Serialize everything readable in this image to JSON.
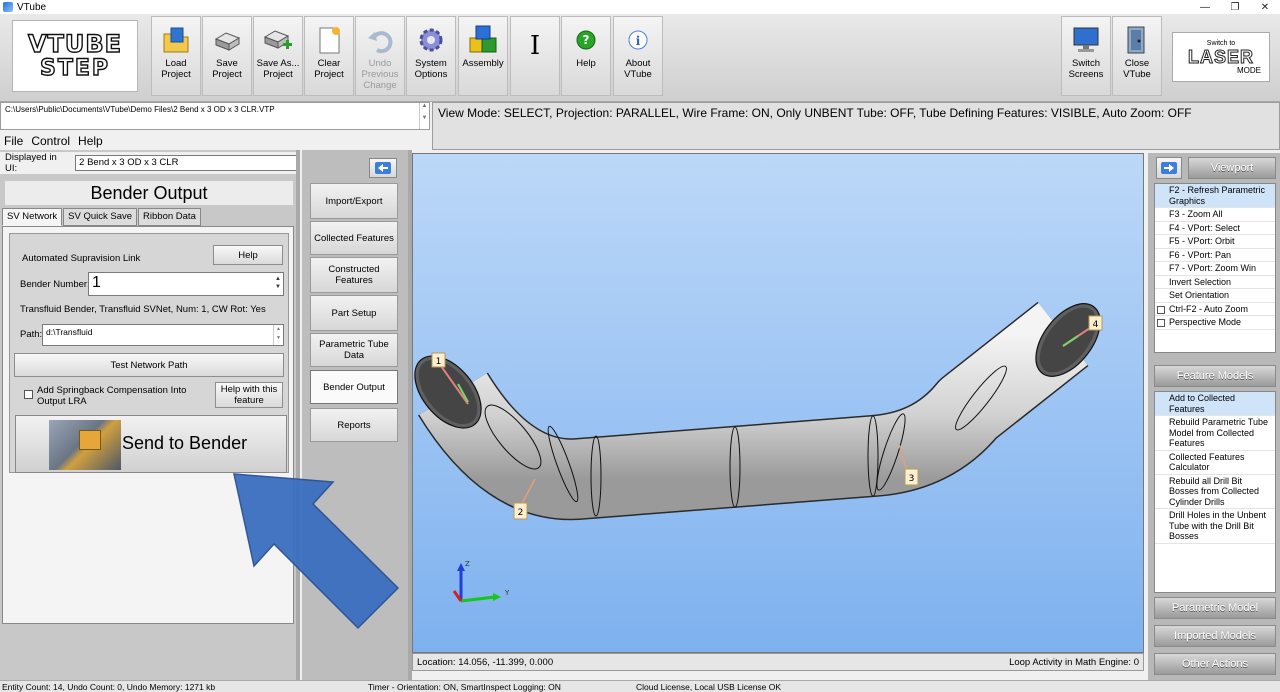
{
  "window": {
    "title": "VTube"
  },
  "logo": {
    "line1": "VTUBE",
    "line2": "STEP"
  },
  "ribbon": {
    "buttons": [
      {
        "id": "load",
        "label": "Load Project"
      },
      {
        "id": "save",
        "label": "Save Project"
      },
      {
        "id": "saveas",
        "label": "Save As... Project"
      },
      {
        "id": "clear",
        "label": "Clear Project"
      },
      {
        "id": "undo",
        "label": "Undo Previous Change"
      },
      {
        "id": "sysopt",
        "label": "System Options"
      },
      {
        "id": "assembly",
        "label": "Assembly"
      },
      {
        "id": "cursor",
        "label": ""
      },
      {
        "id": "help",
        "label": "Help"
      },
      {
        "id": "about",
        "label": "About VTube"
      },
      {
        "id": "switch",
        "label": "Switch Screens"
      },
      {
        "id": "close",
        "label": "Close VTube"
      }
    ],
    "laser_mode": {
      "top": "Switch to",
      "main": "LASER",
      "bottom": "MODE"
    }
  },
  "file_path": "C:\\Users\\Public\\Documents\\VTube\\Demo Files\\2 Bend x 3 OD x 3 CLR.VTP",
  "view_mode": "View Mode: SELECT, Projection: PARALLEL, Wire Frame: ON, Only UNBENT Tube: OFF, Tube Defining Features: VISIBLE, Auto Zoom: OFF",
  "menu": {
    "file": "File",
    "control": "Control",
    "help": "Help"
  },
  "left": {
    "displayed_label": "Displayed in UI:",
    "displayed_value": "2 Bend x 3 OD x 3 CLR",
    "header": "Bender Output",
    "tabs": [
      "SV Network",
      "SV Quick Save",
      "Ribbon Data"
    ],
    "auto_link": "Automated Supravision Link",
    "help_button": "Help",
    "bender_number_label": "Bender Number:",
    "bender_number_value": "1",
    "transfluid_info": "Transfluid Bender, Transfluid SVNet, Num: 1, CW Rot: Yes",
    "path_label": "Path:",
    "path_value": "d:\\Transfluid",
    "test_button": "Test Network Path",
    "springback_label": "Add Springback Compensation Into Output LRA",
    "help_feature_button": "Help with this feature",
    "send_button": "Send to Bender"
  },
  "middle_nav": [
    "Import/Export",
    "Collected Features",
    "Constructed Features",
    "Part Setup",
    "Parametric Tube Data",
    "Bender Output",
    "Reports"
  ],
  "viewport": {
    "markers": [
      "1",
      "2",
      "3",
      "4"
    ],
    "axes": {
      "z": "Z",
      "y": "Y"
    },
    "location": "Location: 14.056, -11.399, 0.000",
    "loop_activity": "Loop Activity in Math Engine:  0"
  },
  "right": {
    "viewport_header": "Viewport",
    "viewport_items": [
      "F2 - Refresh Parametric Graphics",
      "F3 - Zoom All",
      "F4 - VPort: Select",
      "F5 - VPort: Orbit",
      "F6 - VPort: Pan",
      "F7 - VPort: Zoom Win",
      "Invert Selection",
      "Set Orientation",
      "Ctrl-F2 - Auto Zoom",
      "Perspective Mode"
    ],
    "feature_models_header": "Feature Models",
    "feature_items": [
      "Add to Collected Features",
      "Rebuild Parametric Tube Model from Collected Features",
      "Collected Features Calculator",
      "Rebuild all Drill Bit Bosses from Collected Cylinder Drills",
      "Drill Holes in the Unbent Tube with the Drill Bit Bosses"
    ],
    "parametric_model": "Parametric Model",
    "imported_models": "Imported Models",
    "other_actions": "Other Actions"
  },
  "statusbar": {
    "entity": "Entity Count: 14, Undo Count: 0, Undo Memory: 1271 kb",
    "timer": "Timer - Orientation: ON, SmartInspect Logging: ON",
    "license": "Cloud License, Local USB License OK"
  },
  "colors": {
    "viewport_top": "#bcd8f8",
    "viewport_bottom": "#7eb1ef",
    "arrow": "#3b6fc1",
    "ribbon": "#d8d8d8"
  }
}
